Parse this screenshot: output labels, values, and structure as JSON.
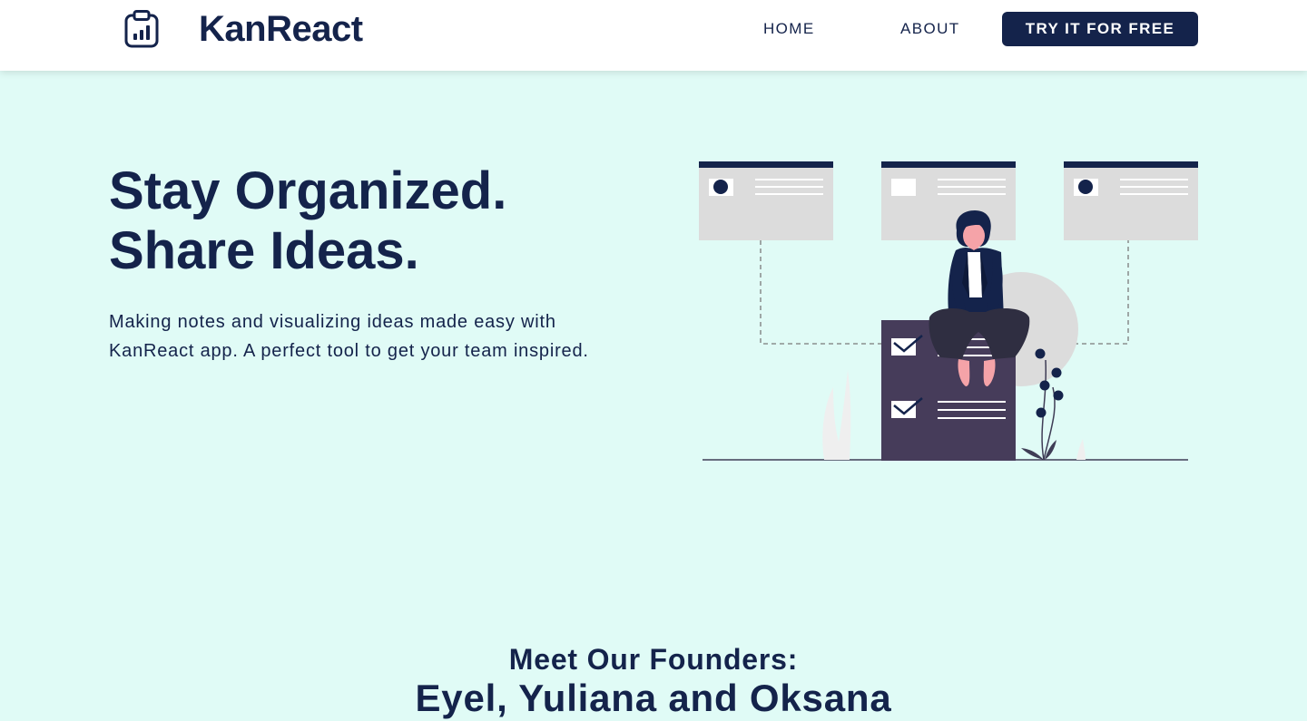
{
  "header": {
    "brand": "KanReact",
    "logo_icon": "clipboard-chart-icon",
    "nav": [
      {
        "label": "HOME"
      },
      {
        "label": "ABOUT"
      }
    ],
    "cta_label": "TRY IT FOR FREE"
  },
  "hero": {
    "title_line1": "Stay Organized.",
    "title_line2": "Share Ideas.",
    "description": "Making notes and visualizing ideas made easy with KanReact app. A perfect tool to get your team inspired.",
    "illustration": "woman-sitting-on-kanban-board-illustration"
  },
  "founders": {
    "heading": "Meet Our Founders:",
    "names": "Eyel, Yuliana and Oksana"
  },
  "colors": {
    "primary": "#14234b",
    "background": "#e0fbf6",
    "card": "#dcdcdc",
    "board": "#463c5a",
    "accent_skin": "#f5a3a8"
  }
}
